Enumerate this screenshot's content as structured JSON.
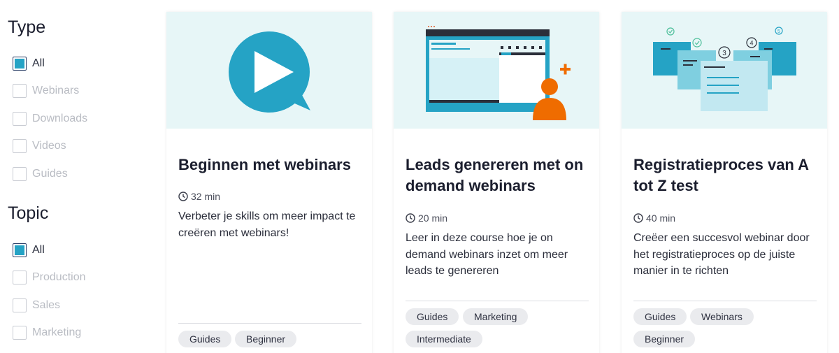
{
  "filters": {
    "type": {
      "title": "Type",
      "options": [
        {
          "label": "All",
          "checked": true
        },
        {
          "label": "Webinars",
          "checked": false
        },
        {
          "label": "Downloads",
          "checked": false
        },
        {
          "label": "Videos",
          "checked": false
        },
        {
          "label": "Guides",
          "checked": false
        }
      ]
    },
    "topic": {
      "title": "Topic",
      "options": [
        {
          "label": "All",
          "checked": true
        },
        {
          "label": "Production",
          "checked": false
        },
        {
          "label": "Sales",
          "checked": false
        },
        {
          "label": "Marketing",
          "checked": false
        }
      ]
    }
  },
  "cards": [
    {
      "title": "Beginnen met webinars",
      "duration": "32 min",
      "description": "Verbeter je skills om meer impact te creëren met webinars!",
      "tags": [
        "Guides",
        "Beginner"
      ],
      "illustration": "play-bubble-icon"
    },
    {
      "title": "Leads genereren met on demand webinars",
      "duration": "20 min",
      "description": "Leer in deze course hoe je on demand webinars inzet om meer leads te genereren",
      "tags": [
        "Guides",
        "Marketing",
        "Intermediate"
      ],
      "illustration": "webinar-screen-add-user-icon"
    },
    {
      "title": "Registratieproces van A tot Z test",
      "duration": "40 min",
      "description": "Creëer een succesvol webinar door het registratieproces op de juiste manier in te richten",
      "tags": [
        "Guides",
        "Webinars",
        "Beginner"
      ],
      "illustration": "registration-steps-icon"
    }
  ],
  "colors": {
    "accent": "#25a3c5",
    "orange": "#ef6c00",
    "media_bg": "#e7f6f7",
    "tag_bg": "#eaebee"
  }
}
